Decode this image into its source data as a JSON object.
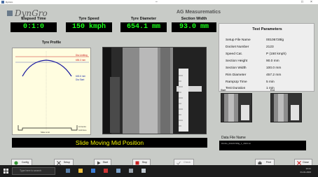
{
  "window": {
    "title": "DynGro"
  },
  "header": {
    "logo_text": "DynGro",
    "brand": "AG Measurematics"
  },
  "metrics": [
    {
      "label": "Elapsed Time",
      "value": "0:1:0"
    },
    {
      "label": "Tyre Speed",
      "value": "150 kmph"
    },
    {
      "label": "Tyre Diameter",
      "value": "654.1 mm"
    },
    {
      "label": "Section Width",
      "value": "93.0 mm"
    }
  ],
  "profile": {
    "title": "Tyre Profile",
    "dia_limiting_label": "Dia Limiting",
    "dia_limiting_value": "655.3 mm",
    "dia_start_value": "645.6 mm",
    "dia_start_label": "Dia Start",
    "bottom_label": "Slide Limit",
    "legend_1": "At Centre",
    "legend_2": "Grid Zone"
  },
  "params": {
    "title": "Test Parameters",
    "rows": [
      {
        "key": "Setup File Name",
        "value": "00106728lg"
      },
      {
        "key": "Docket Number",
        "value": "2123"
      },
      {
        "key": "Speed Cat.",
        "value": "P (150 kmph)"
      },
      {
        "key": "Section Height",
        "value": "90.0 mm"
      },
      {
        "key": "Section Width",
        "value": "100.0 mm"
      },
      {
        "key": "Rim Diameter",
        "value": "457.2 mm"
      },
      {
        "key": "RampUp Time",
        "value": "5 min"
      },
      {
        "key": "Test Duration",
        "value": "1 min"
      }
    ]
  },
  "thumbs": {
    "start_label": "Start",
    "end_label": "End"
  },
  "status": {
    "message": "Slide Moving Mid Position"
  },
  "data_file": {
    "label": "Data File Name",
    "value": "DGSG_00106728lg_1_2023.txt"
  },
  "buttons": {
    "config": "Config",
    "setup": "Setup",
    "start": "Start",
    "stop": "Stop",
    "check": "Check",
    "print": "Print",
    "close": "Close"
  },
  "taskbar": {
    "search_placeholder": "Type here to search",
    "time": "10:41",
    "date": "01-01-2023"
  },
  "colors": {
    "readout_text": "#19ff19",
    "status_text": "#f5f500",
    "dia_limiting": "#cc2222",
    "dia_start": "#2233aa",
    "profile_curve": "#1a1aa0",
    "profile_bg": "#fffde0",
    "stop_icon": "#cc2222",
    "close_icon": "#cc2222"
  }
}
